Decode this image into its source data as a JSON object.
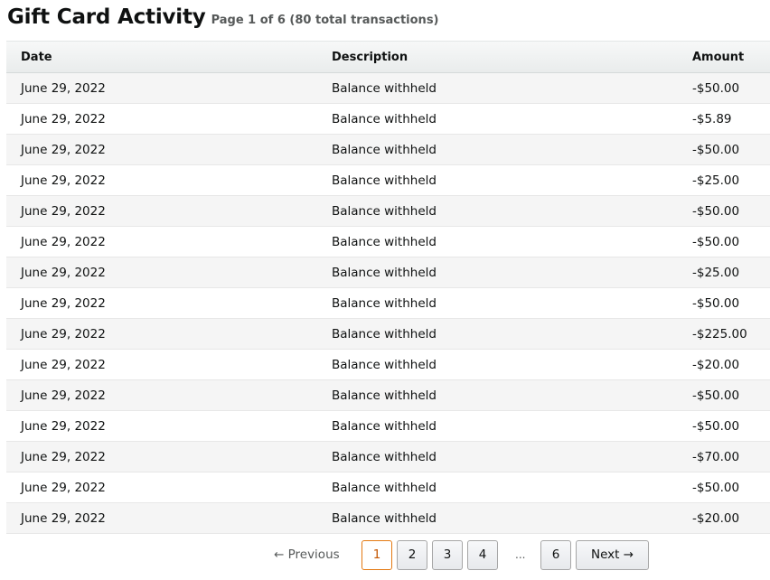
{
  "header": {
    "title": "Gift Card Activity",
    "subtitle": "Page 1 of 6 (80 total transactions)"
  },
  "table": {
    "columns": [
      "Date",
      "Description",
      "Amount"
    ],
    "rows": [
      {
        "date": "June 29, 2022",
        "description": "Balance withheld",
        "amount": "-$50.00"
      },
      {
        "date": "June 29, 2022",
        "description": "Balance withheld",
        "amount": "-$5.89"
      },
      {
        "date": "June 29, 2022",
        "description": "Balance withheld",
        "amount": "-$50.00"
      },
      {
        "date": "June 29, 2022",
        "description": "Balance withheld",
        "amount": "-$25.00"
      },
      {
        "date": "June 29, 2022",
        "description": "Balance withheld",
        "amount": "-$50.00"
      },
      {
        "date": "June 29, 2022",
        "description": "Balance withheld",
        "amount": "-$50.00"
      },
      {
        "date": "June 29, 2022",
        "description": "Balance withheld",
        "amount": "-$25.00"
      },
      {
        "date": "June 29, 2022",
        "description": "Balance withheld",
        "amount": "-$50.00"
      },
      {
        "date": "June 29, 2022",
        "description": "Balance withheld",
        "amount": "-$225.00"
      },
      {
        "date": "June 29, 2022",
        "description": "Balance withheld",
        "amount": "-$20.00"
      },
      {
        "date": "June 29, 2022",
        "description": "Balance withheld",
        "amount": "-$50.00"
      },
      {
        "date": "June 29, 2022",
        "description": "Balance withheld",
        "amount": "-$50.00"
      },
      {
        "date": "June 29, 2022",
        "description": "Balance withheld",
        "amount": "-$70.00"
      },
      {
        "date": "June 29, 2022",
        "description": "Balance withheld",
        "amount": "-$50.00"
      },
      {
        "date": "June 29, 2022",
        "description": "Balance withheld",
        "amount": "-$20.00"
      }
    ]
  },
  "pagination": {
    "previous_label": "← Previous",
    "pages": [
      "1",
      "2",
      "3",
      "4",
      "6"
    ],
    "current_page": "1",
    "ellipsis": "...",
    "next_label": "Next →"
  },
  "colors": {
    "active_page_border": "#e47911",
    "active_page_text": "#c45500"
  }
}
